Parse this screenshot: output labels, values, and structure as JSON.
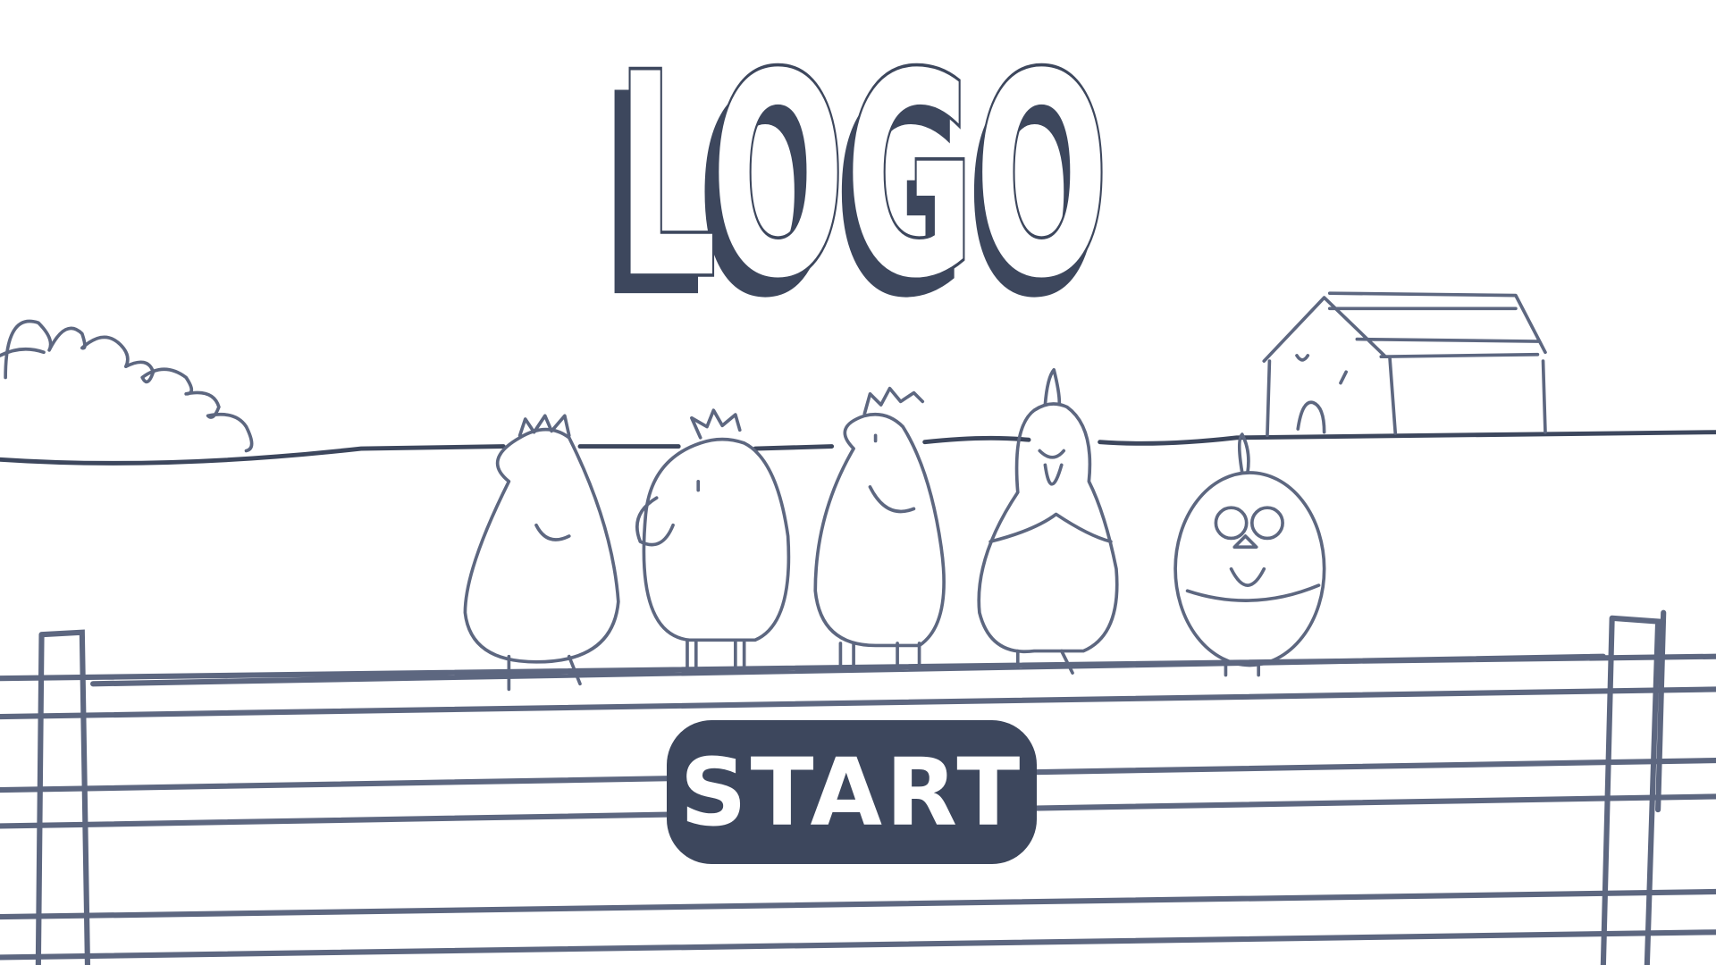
{
  "title": {
    "logo_text": "LOGO"
  },
  "menu": {
    "start_label": "START"
  },
  "colors": {
    "ink": "#3d475d",
    "sketch": "#5d6780",
    "background": "#ffffff"
  },
  "scene": {
    "characters": [
      "chicken",
      "chicken",
      "chicken",
      "chicken",
      "chicken"
    ],
    "props": [
      "fence",
      "bush",
      "barn",
      "hill"
    ]
  }
}
